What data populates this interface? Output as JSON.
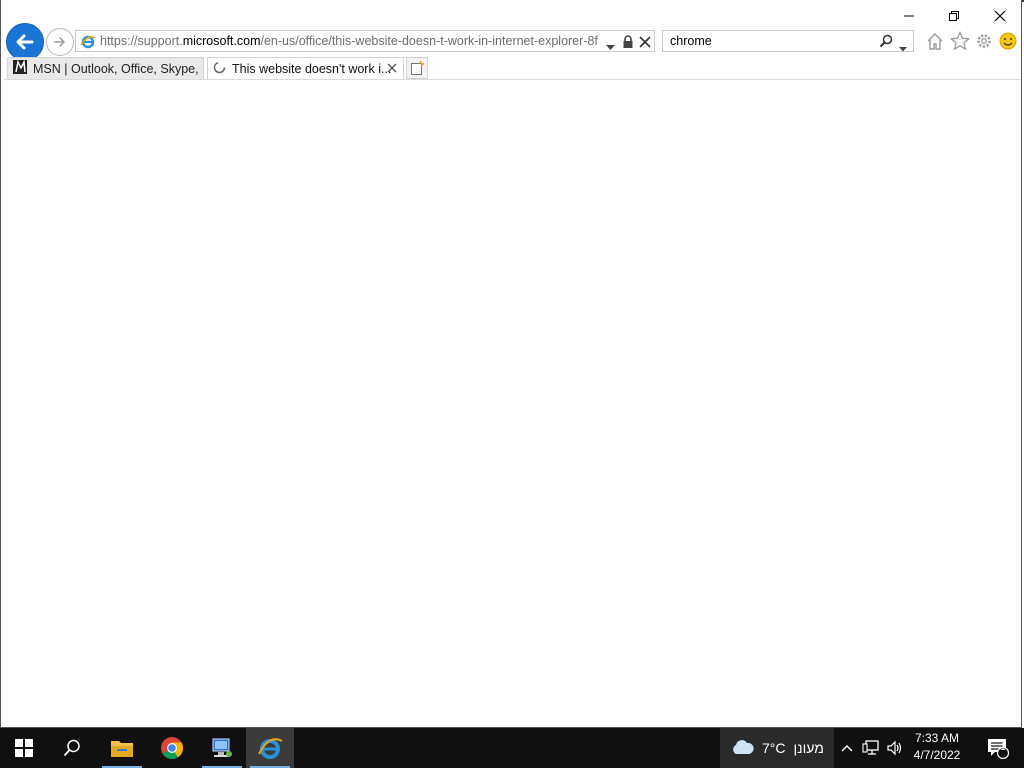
{
  "address_bar": {
    "url_scheme": "https://support.",
    "url_domain": "microsoft.com",
    "url_path": "/en-us/office/this-website-doesn-t-work-in-internet-explorer-8f"
  },
  "search_box": {
    "value": "chrome"
  },
  "tabs": [
    {
      "label": "MSN | Outlook, Office, Skype, ...",
      "active": false
    },
    {
      "label": "This website doesn't work i...",
      "active": true
    }
  ],
  "taskbar": {
    "weather": {
      "temp": "7°C",
      "condition": "מעונן"
    },
    "clock": {
      "time": "7:33 AM",
      "date": "4/7/2022"
    },
    "notification_count": "1"
  },
  "colors": {
    "accent": "#1a74d4",
    "taskbar": "#101010",
    "running_indicator": "#7aaedf"
  }
}
